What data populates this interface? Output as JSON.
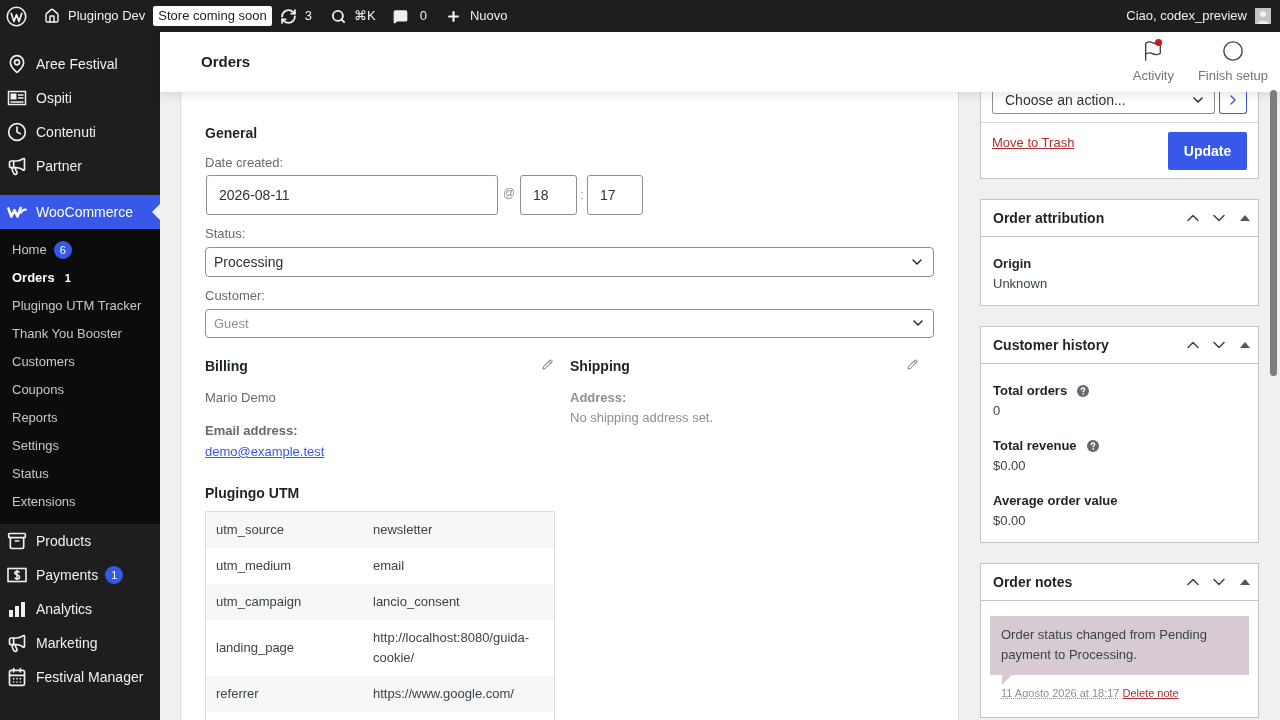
{
  "admin_bar": {
    "site_name": "Plugingo Dev",
    "store_badge": "Store coming soon",
    "updates_count": "3",
    "search_shortcut": "⌘K",
    "comments_count": "0",
    "new_label": "Nuovo",
    "greeting": "Ciao, codex_preview"
  },
  "sidebar": {
    "groups": [
      {
        "items": [
          {
            "label": "Aree Festival",
            "selected": false
          },
          {
            "label": "Ospiti",
            "selected": false
          },
          {
            "label": "Contenuti",
            "selected": false
          },
          {
            "label": "Partner",
            "selected": false
          }
        ]
      },
      {
        "items": [
          {
            "label": "WooCommerce",
            "selected": true,
            "submenu": [
              {
                "label": "Home",
                "count": "6",
                "selected": false
              },
              {
                "label": "Orders",
                "count": "1",
                "selected": true
              },
              {
                "label": "Plugingo UTM Tracker",
                "selected": false
              },
              {
                "label": "Thank You Booster",
                "selected": false
              },
              {
                "label": "Customers",
                "selected": false
              },
              {
                "label": "Coupons",
                "selected": false
              },
              {
                "label": "Reports",
                "selected": false
              },
              {
                "label": "Settings",
                "selected": false
              },
              {
                "label": "Status",
                "selected": false
              },
              {
                "label": "Extensions",
                "selected": false
              }
            ]
          },
          {
            "label": "Products",
            "selected": false
          },
          {
            "label": "Payments",
            "count": "1",
            "selected": false
          },
          {
            "label": "Analytics",
            "selected": false
          },
          {
            "label": "Marketing",
            "selected": false
          },
          {
            "label": "Festival Manager",
            "selected": false
          }
        ]
      }
    ]
  },
  "header": {
    "title": "Orders",
    "actions": [
      {
        "label": "Activity",
        "unread": true
      },
      {
        "label": "Finish setup",
        "unread": false
      }
    ]
  },
  "order": {
    "general": {
      "heading": "General",
      "date_label": "Date created:",
      "date": "2026-08-11",
      "at": "@",
      "hour": "18",
      "colon": ":",
      "minute": "17",
      "status_label": "Status:",
      "status": "Processing",
      "customer_label": "Customer:",
      "customer_placeholder": "Guest"
    },
    "billing": {
      "heading": "Billing",
      "name": "Mario Demo",
      "email_label": "Email address:",
      "email": "demo@example.test"
    },
    "shipping": {
      "heading": "Shipping",
      "address_label": "Address:",
      "address": "No shipping address set."
    },
    "utm": {
      "heading": "Plugingo UTM",
      "rows": [
        {
          "key": "utm_source",
          "value": "newsletter"
        },
        {
          "key": "utm_medium",
          "value": "email"
        },
        {
          "key": "utm_campaign",
          "value": "lancio_consent"
        },
        {
          "key": "landing_page",
          "value": "http://localhost:8080/guida-cookie/"
        },
        {
          "key": "referrer",
          "value": "https://www.google.com/"
        }
      ]
    }
  },
  "actions_box": {
    "action_select": "Choose an action...",
    "trash_link": "Move to Trash",
    "update_button": "Update"
  },
  "boxes": [
    {
      "kind": "fields",
      "title": "Order attribution",
      "expanded": true,
      "fields": [
        {
          "label": "Origin",
          "value": "Unknown",
          "help": false
        }
      ]
    },
    {
      "kind": "fields",
      "title": "Customer history",
      "expanded": true,
      "fields": [
        {
          "label": "Total orders",
          "value": "0",
          "help": true
        },
        {
          "label": "Total revenue",
          "value": "$0.00",
          "help": true
        },
        {
          "label": "Average order value",
          "value": "$0.00",
          "help": false
        }
      ]
    },
    {
      "kind": "notes",
      "title": "Order notes",
      "expanded": true,
      "notes": [
        {
          "text": "Order status changed from Pending payment to Processing.",
          "date": "11 Agosto 2026 at 18:17",
          "delete_label": "Delete note"
        }
      ]
    }
  ]
}
